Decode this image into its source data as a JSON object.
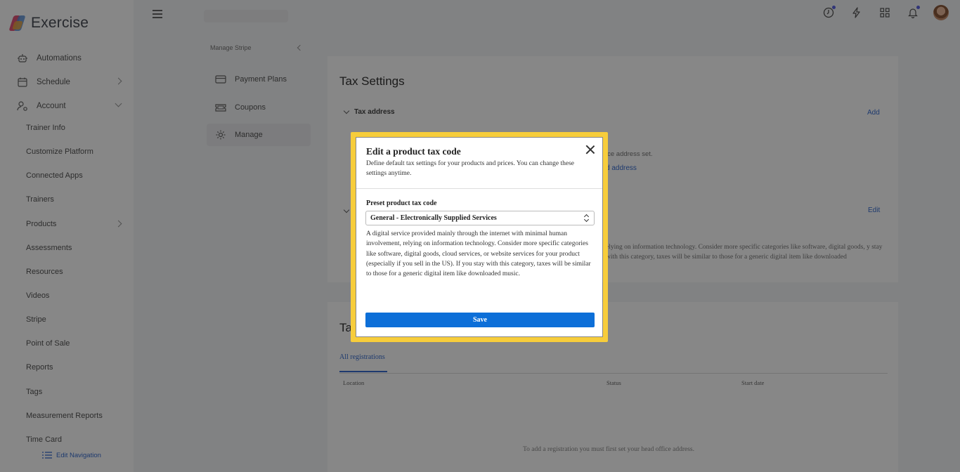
{
  "app": {
    "name": "Exercise"
  },
  "sidebar": {
    "top_items": [
      {
        "label": "Automations",
        "icon": "robot-icon"
      },
      {
        "label": "Schedule",
        "icon": "calendar-icon"
      },
      {
        "label": "Account",
        "icon": "user-settings-icon"
      }
    ],
    "sub_items": [
      "Trainer Info",
      "Customize Platform",
      "Connected Apps",
      "Trainers",
      "Products",
      "Assessments",
      "Resources",
      "Videos",
      "Stripe",
      "Point of Sale",
      "Reports",
      "Tags",
      "Measurement Reports",
      "Time Card"
    ],
    "edit_navigation": "Edit Navigation"
  },
  "topbar": {
    "icons": [
      "clock-icon",
      "lightning-icon",
      "apps-grid-icon",
      "bell-icon",
      "avatar"
    ]
  },
  "panel": {
    "title": "Manage Stripe",
    "items": [
      {
        "label": "Payment Plans",
        "icon": "credit-card-icon"
      },
      {
        "label": "Coupons",
        "icon": "ticket-icon"
      },
      {
        "label": "Manage",
        "icon": "gear-icon",
        "active": true
      }
    ]
  },
  "main": {
    "title": "Tax Settings",
    "tax_address_section": "Tax address",
    "add_link": "Add",
    "edit_link": "Edit",
    "bg_text_1": "ice address set.",
    "bg_text_2": "d address",
    "bg_desc": "elying on information technology. Consider more specific categories like software, digital goods, y stay with this category, taxes will be similar to those for a generic digital item like downloaded"
  },
  "registrations": {
    "title": "Ta",
    "tab": "All registrations",
    "columns": [
      "Location",
      "Status",
      "Start date"
    ],
    "empty_message": "To add a registration you must first set your head office address."
  },
  "modal": {
    "title": "Edit a product tax code",
    "subtitle": "Define default tax settings for your products and prices. You can change these settings anytime.",
    "field_label": "Preset product tax code",
    "selected_value": "General - Electronically Supplied Services",
    "description": "A digital service provided mainly through the internet with minimal human involvement, relying on information technology. Consider more specific categories like software, digital goods, cloud services, or website services for your product (especially if you sell in the US). If you stay with this category, taxes will be similar to those for a generic digital item like downloaded music.",
    "save_label": "Save"
  },
  "colors": {
    "accent": "#0d6fd8",
    "highlight": "#f7cd3b",
    "notification_dot": "#5b63e0"
  }
}
